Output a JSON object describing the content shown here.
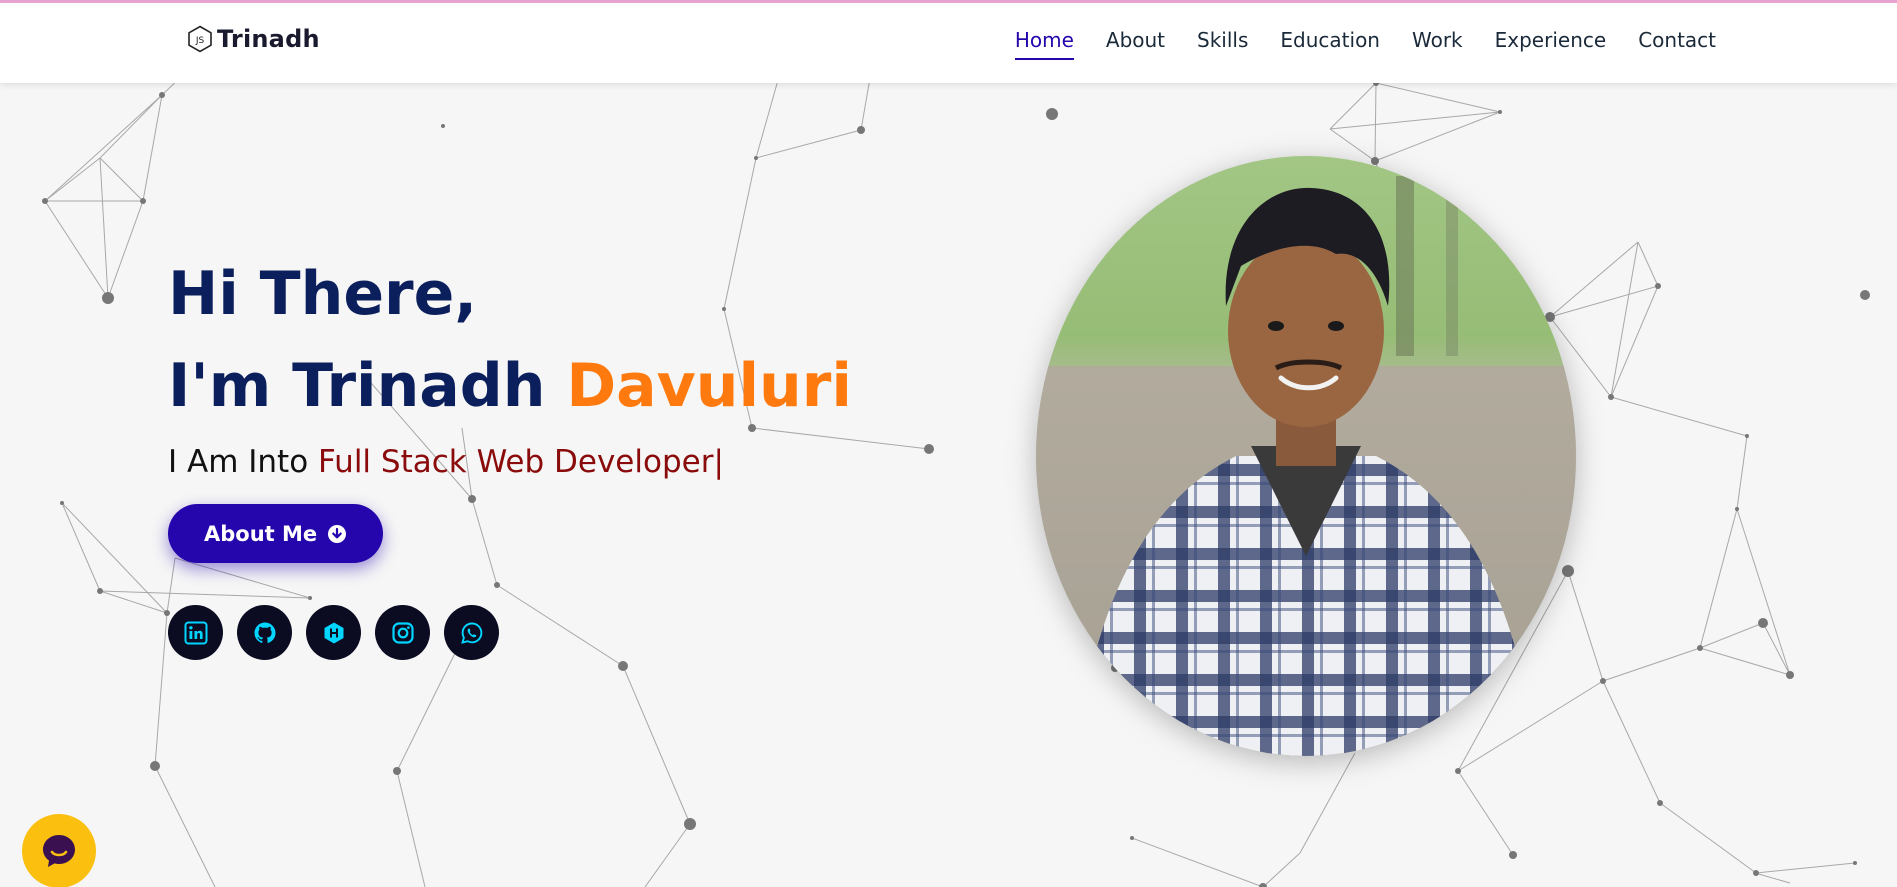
{
  "brand": {
    "name": "Trinadh",
    "icon": "nodejs-hex-icon"
  },
  "nav": {
    "items": [
      {
        "label": "Home",
        "active": true
      },
      {
        "label": "About",
        "active": false
      },
      {
        "label": "Skills",
        "active": false
      },
      {
        "label": "Education",
        "active": false
      },
      {
        "label": "Work",
        "active": false
      },
      {
        "label": "Experience",
        "active": false
      },
      {
        "label": "Contact",
        "active": false
      }
    ]
  },
  "hero": {
    "greeting": "Hi There,",
    "intro_prefix": "I'm Trinadh ",
    "intro_surname": "Davuluri",
    "typed_prefix": "I Am Into ",
    "typed_role": "Full Stack Web Developer|",
    "about_button": "About Me",
    "about_button_icon": "arrow-down-circle-icon"
  },
  "socials": [
    {
      "name": "linkedin-icon"
    },
    {
      "name": "github-icon"
    },
    {
      "name": "hashnode-icon"
    },
    {
      "name": "instagram-icon"
    },
    {
      "name": "whatsapp-icon"
    }
  ],
  "colors": {
    "accent": "#2506ad",
    "heading": "#0b1f5c",
    "surname": "#ff7a0e",
    "role": "#8a0b0b",
    "social_bg": "#0b0b22",
    "social_icon": "#00d5ff",
    "chat_bubble": "#fbbf10"
  },
  "chat": {
    "icon": "chat-bubble-icon"
  }
}
